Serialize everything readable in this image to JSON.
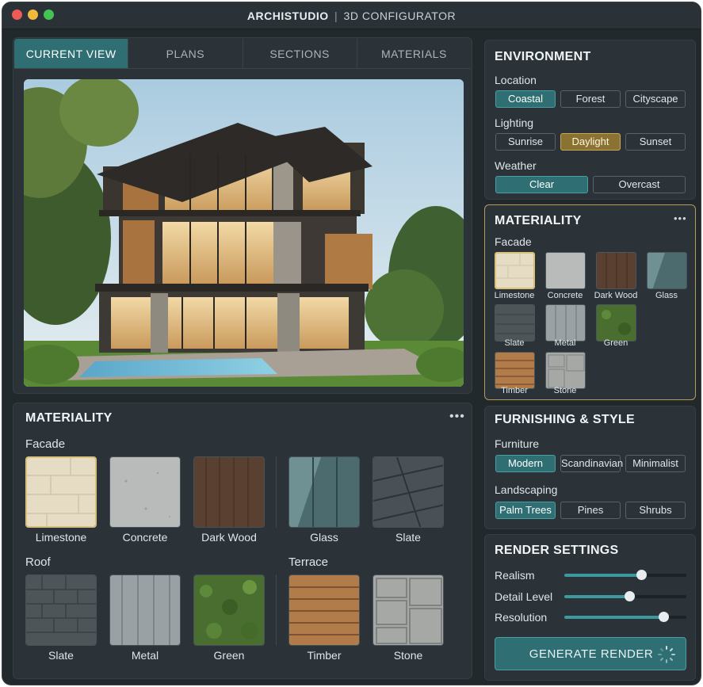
{
  "window": {
    "title_brand": "ARCHISTUDIO",
    "title_sep": "|",
    "title_rest": "3D CONFIGURATOR"
  },
  "tabs": [
    {
      "label": "CURRENT VIEW",
      "active": true
    },
    {
      "label": "PLANS",
      "active": false
    },
    {
      "label": "SECTIONS",
      "active": false
    },
    {
      "label": "MATERIALS",
      "active": false
    }
  ],
  "materiality_main": {
    "title": "MATERIALITY",
    "more": "•••",
    "facade": {
      "label": "Facade",
      "items": [
        "Limestone",
        "Concrete",
        "Dark Wood",
        "Glass",
        "Slate"
      ]
    },
    "roof": {
      "label": "Roof",
      "items": [
        "Slate",
        "Metal",
        "Green"
      ]
    },
    "terrace": {
      "label": "Terrace",
      "items": [
        "Timber",
        "Stone"
      ]
    }
  },
  "environment": {
    "title": "ENVIRONMENT",
    "location_label": "Location",
    "location_options": [
      "Coastal",
      "Forest",
      "Cityscape"
    ],
    "location_selected": "Coastal",
    "lighting_label": "Lighting",
    "lighting_options": [
      "Sunrise",
      "Daylight",
      "Sunset"
    ],
    "lighting_selected": "Daylight",
    "weather_label": "Weather",
    "weather_options": [
      "Clear",
      "Overcast"
    ],
    "weather_selected": "Clear"
  },
  "materiality_side": {
    "title": "MATERIALITY",
    "more": "•••",
    "section_label": "Facade",
    "items": [
      "Limestone",
      "Concrete",
      "Dark Wood",
      "Glass",
      "Slate",
      "Metal",
      "Green",
      "Timber",
      "Stone"
    ]
  },
  "furnishing": {
    "title": "FURNISHING & STYLE",
    "furniture_label": "Furniture",
    "furniture_options": [
      "Modern",
      "Scandinavian",
      "Minimalist"
    ],
    "furniture_selected": "Modern",
    "landscaping_label": "Landscaping",
    "landscaping_options": [
      "Palm Trees",
      "Pines",
      "Shrubs"
    ],
    "landscaping_selected": "Palm Trees"
  },
  "render": {
    "title": "RENDER SETTINGS",
    "sliders": [
      {
        "label": "Realism",
        "value": 0.63
      },
      {
        "label": "Detail Level",
        "value": 0.53
      },
      {
        "label": "Resolution",
        "value": 0.81
      }
    ],
    "generate_label": "GENERATE RENDER"
  },
  "colors": {
    "accent": "#2f6f73",
    "selected_gold": "#d9c07a",
    "panel": "#2b3338"
  }
}
